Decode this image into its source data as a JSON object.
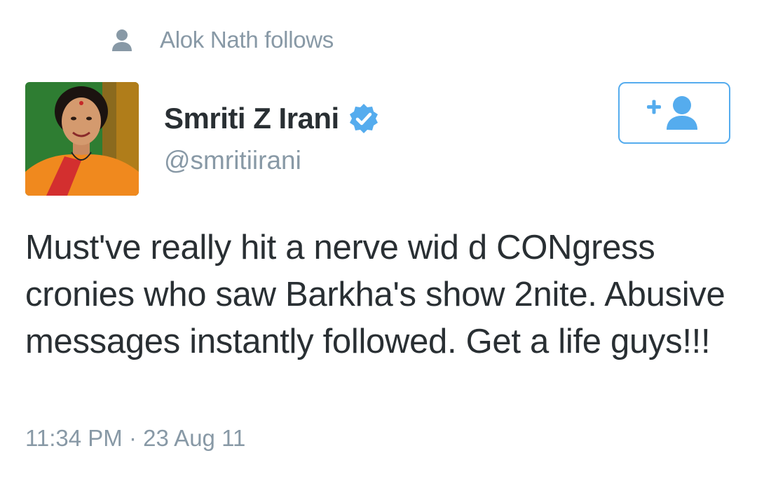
{
  "context": {
    "icon": "person-icon",
    "text": "Alok Nath follows"
  },
  "user": {
    "avatar_icon": "profile-photo",
    "name": "Smriti Z Irani",
    "verified_icon": "verified-badge-icon",
    "handle": "@smritiirani"
  },
  "follow_button": {
    "icon": "follow-add-user-icon"
  },
  "tweet": {
    "text": "Must've really hit a nerve wid d CONgress cronies who saw Barkha's show 2nite. Abusive messages instantly followed. Get a life guys!!!",
    "timestamp": "11:34 PM · 23 Aug 11"
  },
  "colors": {
    "accent": "#55acee",
    "verified": "#55acee",
    "muted_text": "#8899a6",
    "body_text": "#292f33"
  }
}
